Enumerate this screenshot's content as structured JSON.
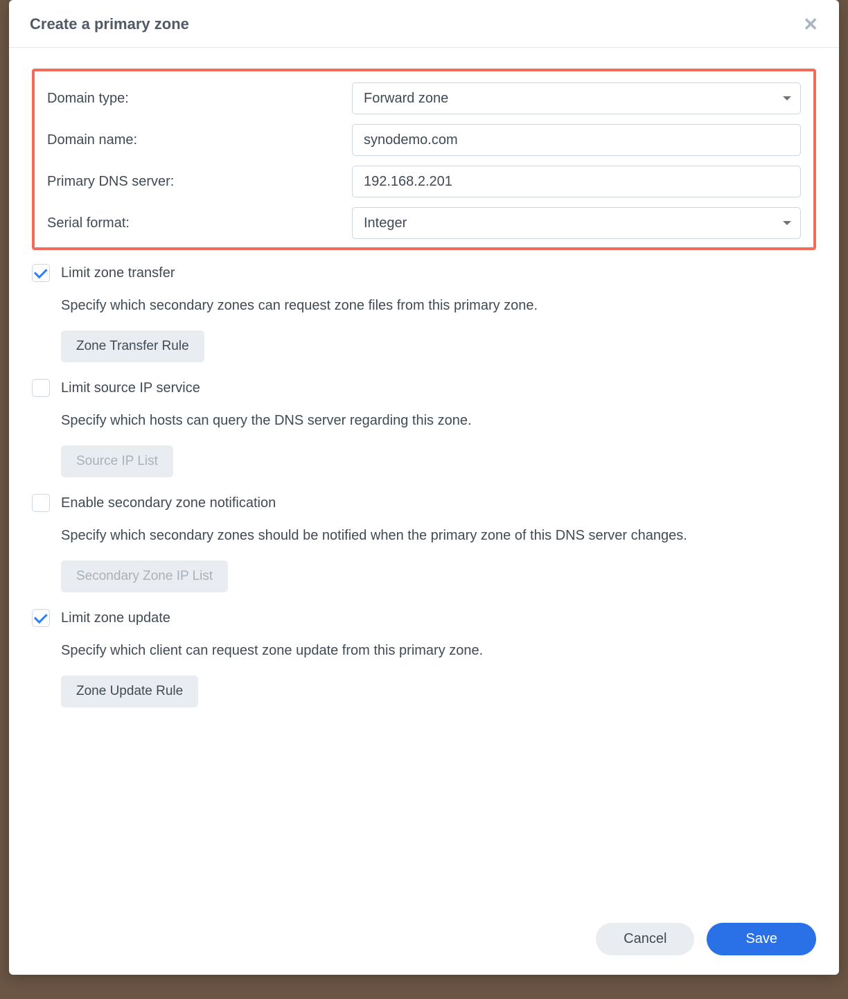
{
  "dialog": {
    "title": "Create a primary zone"
  },
  "fields": {
    "domain_type": {
      "label": "Domain type:",
      "value": "Forward zone"
    },
    "domain_name": {
      "label": "Domain name:",
      "value": "synodemo.com"
    },
    "primary_dns": {
      "label": "Primary DNS server:",
      "value": "192.168.2.201"
    },
    "serial_format": {
      "label": "Serial format:",
      "value": "Integer"
    }
  },
  "sections": {
    "limit_transfer": {
      "checked": true,
      "label": "Limit zone transfer",
      "desc": "Specify which secondary zones can request zone files from this primary zone.",
      "button": "Zone Transfer Rule",
      "button_enabled": true
    },
    "limit_source_ip": {
      "checked": false,
      "label": "Limit source IP service",
      "desc": "Specify which hosts can query the DNS server regarding this zone.",
      "button": "Source IP List",
      "button_enabled": false
    },
    "enable_secondary_notif": {
      "checked": false,
      "label": "Enable secondary zone notification",
      "desc": "Specify which secondary zones should be notified when the primary zone of this DNS server changes.",
      "button": "Secondary Zone IP List",
      "button_enabled": false
    },
    "limit_update": {
      "checked": true,
      "label": "Limit zone update",
      "desc": "Specify which client can request zone update from this primary zone.",
      "button": "Zone Update Rule",
      "button_enabled": true
    }
  },
  "footer": {
    "cancel": "Cancel",
    "save": "Save"
  }
}
